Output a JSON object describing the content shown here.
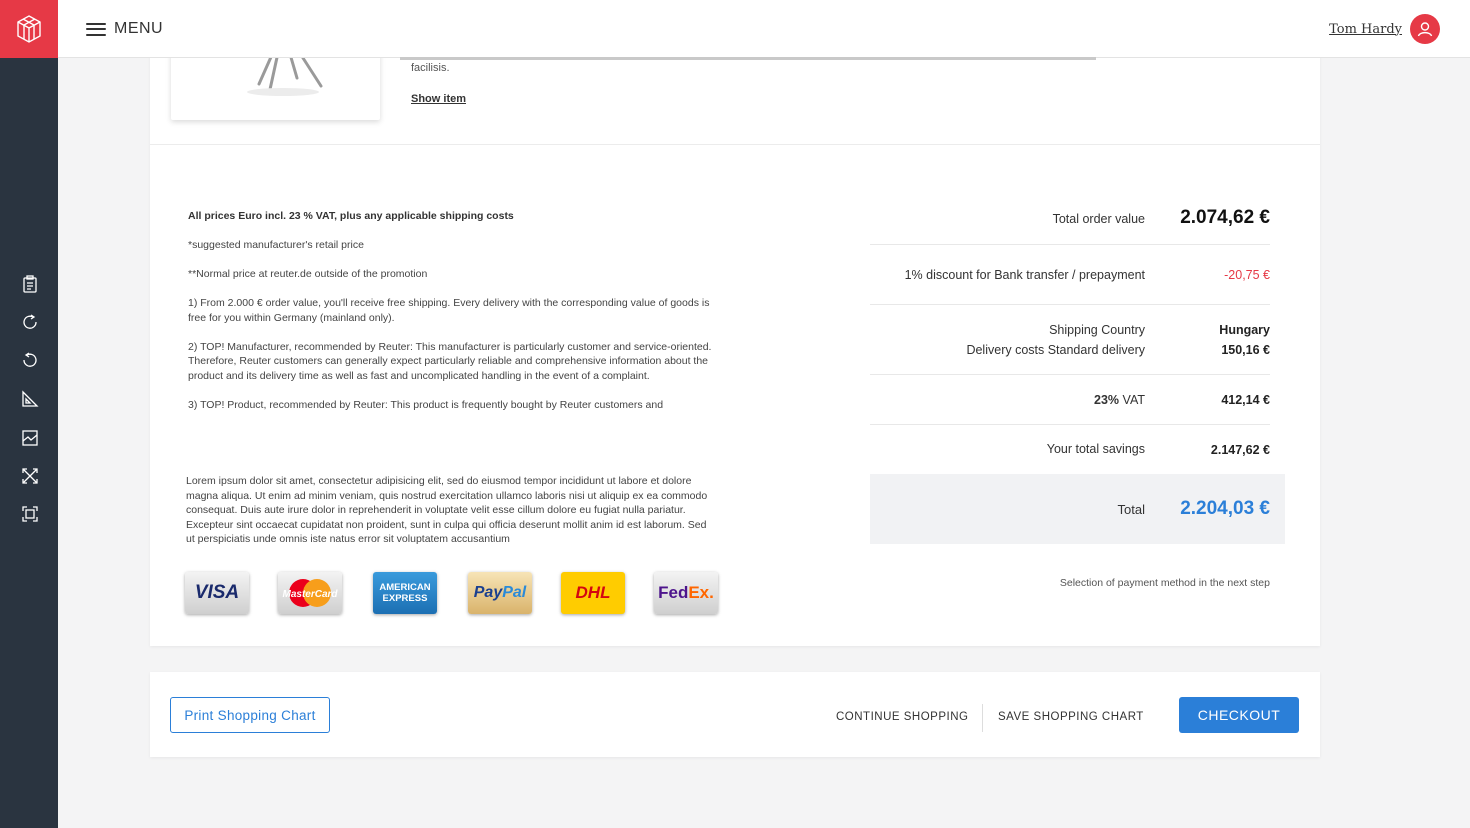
{
  "header": {
    "menu_label": "MENU",
    "user_name": "Tom Hardy",
    "brand_color": "#e63946"
  },
  "sidebar": {
    "icons": [
      "clipboard-icon",
      "redo-icon",
      "undo-icon",
      "set-square-icon",
      "image-frame-icon",
      "expand-arrows-icon",
      "fit-frame-icon"
    ]
  },
  "product": {
    "description_tail": "facilisis.",
    "show_item_label": "Show item"
  },
  "notes": {
    "vat_note": "All prices Euro incl. 23 % VAT, plus any applicable shipping costs",
    "msrp_note": "*suggested manufacturer's retail price",
    "normal_price_note": "**Normal price at reuter.de outside of the promotion",
    "note_1": "1) From 2.000 € order value, you'll receive free shipping. Every delivery with the corresponding value of goods is free for you within Germany (mainland only).",
    "note_2": "2) TOP! Manufacturer, recommended by Reuter: This manufacturer is particularly customer and service-oriented. Therefore, Reuter customers can generally expect particularly reliable and comprehensive information about the product and its delivery time as well as fast and uncomplicated handling in the event of a complaint.",
    "note_3": "3) TOP! Product, recommended by Reuter: This product is frequently bought by Reuter customers and",
    "lorem": "Lorem ipsum dolor sit amet, consectetur adipisicing elit, sed do eiusmod tempor incididunt ut labore et dolore magna aliqua. Ut enim ad minim veniam, quis nostrud exercitation ullamco laboris nisi ut aliquip ex ea commodo consequat. Duis aute irure dolor in reprehenderit in voluptate velit esse cillum dolore eu fugiat nulla pariatur. Excepteur sint occaecat cupidatat non proident, sunt in culpa qui officia deserunt mollit anim id est laborum. Sed ut perspiciatis unde omnis iste natus error sit voluptatem accusantium"
  },
  "payment_logos": {
    "visa": "VISA",
    "mastercard": "MasterCard",
    "amex_line1": "AMERICAN",
    "amex_line2": "EXPRESS",
    "paypal_a": "Pay",
    "paypal_b": "Pal",
    "dhl": "DHL",
    "fedex_a": "Fed",
    "fedex_b": "Ex."
  },
  "summary": {
    "total_order_label": "Total order value",
    "total_order_value": "2.074,62 €",
    "discount_label": "1% discount for Bank transfer / prepayment",
    "discount_value": "-20,75 €",
    "shipping_country_label": "Shipping Country",
    "shipping_country_value": "Hungary",
    "delivery_label": "Delivery costs Standard delivery",
    "delivery_value": "150,16 €",
    "vat_rate": "23%",
    "vat_label": "VAT",
    "vat_value": "412,14 €",
    "savings_label": "Your total savings",
    "savings_value": "2.147,62 €",
    "total_label": "Total",
    "total_value": "2.204,03 €",
    "payment_note": "Selection of payment method in the next step",
    "accent_color": "#2b7fd8",
    "discount_color": "#e63946"
  },
  "actions": {
    "print_label": "Print Shopping Chart",
    "continue_label": "CONTINUE SHOPPING",
    "save_label": "SAVE SHOPPING CHART",
    "checkout_label": "CHECKOUT"
  }
}
